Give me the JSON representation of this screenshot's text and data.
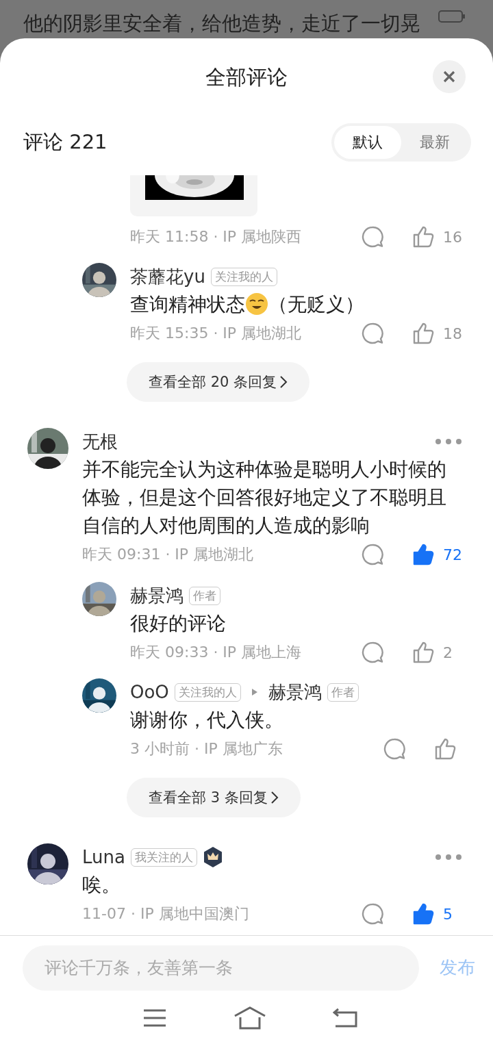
{
  "background_text": "他的阴影里安全着，给他造势，走近了一切晃",
  "sheet": {
    "title": "全部评论",
    "count_label": "评论 221",
    "sort_tabs": [
      {
        "label": "默认",
        "selected": true
      },
      {
        "label": "最新",
        "selected": false
      }
    ]
  },
  "comments": [
    {
      "kind": "partial",
      "meta": "昨天 11:58 · IP 属地陕西",
      "likes": "16",
      "liked": false,
      "replies": [
        {
          "author": "茶蘼花yu",
          "tag": "关注我的人",
          "text": "查询精神状态",
          "emoji": true,
          "text_after": "（无贬义）",
          "meta": "昨天 15:35 · IP 属地湖北",
          "likes": "18",
          "liked": false
        }
      ],
      "more_replies": "查看全部 20 条回复"
    },
    {
      "kind": "full",
      "author": "无根",
      "text": "并不能完全认为这种体验是聪明人小时候的体验，但是这个回答很好地定义了不聪明且自信的人对他周围的人造成的影响",
      "meta": "昨天 09:31 · IP 属地湖北",
      "likes": "72",
      "liked": true,
      "replies": [
        {
          "author": "赫景鸿",
          "tag": "作者",
          "text": "很好的评论",
          "meta": "昨天 09:33 · IP 属地上海",
          "likes": "2",
          "liked": false
        },
        {
          "author": "OoO",
          "tag": "关注我的人",
          "reply_to": "赫景鸿",
          "reply_to_tag": "作者",
          "text": "谢谢你，代入侠。",
          "meta": "3 小时前 · IP 属地广东",
          "liked": false
        }
      ],
      "more_replies": "查看全部 3 条回复"
    },
    {
      "kind": "full",
      "author": "Luna",
      "tag": "我关注的人",
      "crown_badge": true,
      "text": "唉。",
      "meta": "11-07 · IP 属地中国澳门",
      "likes": "5",
      "liked": true
    }
  ],
  "composer": {
    "placeholder": "评论千万条，友善第一条",
    "send": "发布"
  }
}
